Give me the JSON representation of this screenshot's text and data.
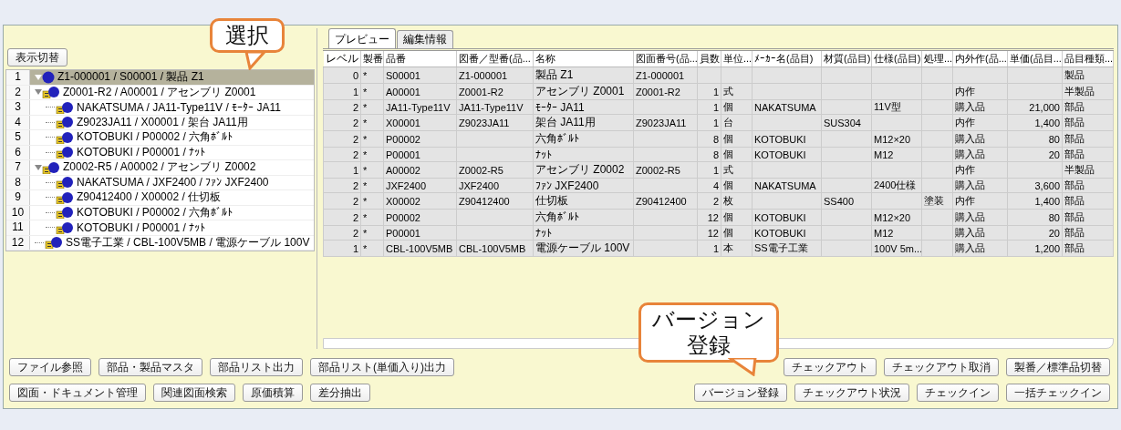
{
  "left_panel": {
    "toggle_button": "表示切替",
    "tree": [
      {
        "number": "1",
        "label": "Z1-000001 / S00001 / 製品 Z1",
        "selected": true,
        "expanded": true,
        "children": [
          {
            "number": "2",
            "label": "Z0001-R2 / A00001 / アセンブリ Z0001",
            "selected": false,
            "expanded": true,
            "children": [
              {
                "number": "3",
                "label": "NAKATSUMA / JA11-Type11V / ﾓｰﾀｰ JA11",
                "selected": false
              },
              {
                "number": "4",
                "label": "Z9023JA11 / X00001 / 架台 JA11用",
                "selected": false
              },
              {
                "number": "5",
                "label": "KOTOBUKI / P00002 / 六角ﾎﾞﾙﾄ",
                "selected": false
              },
              {
                "number": "6",
                "label": "KOTOBUKI / P00001 / ﾅｯﾄ",
                "selected": false
              }
            ]
          },
          {
            "number": "7",
            "label": "Z0002-R5 / A00002 / アセンブリ Z0002",
            "selected": false,
            "expanded": true,
            "children": [
              {
                "number": "8",
                "label": "NAKATSUMA / JXF2400 / ﾌｧﾝ JXF2400",
                "selected": false
              },
              {
                "number": "9",
                "label": "Z90412400 / X00002 / 仕切板",
                "selected": false
              },
              {
                "number": "10",
                "label": "KOTOBUKI / P00002 / 六角ﾎﾞﾙﾄ",
                "selected": false
              },
              {
                "number": "11",
                "label": "KOTOBUKI / P00001 / ﾅｯﾄ",
                "selected": false
              }
            ]
          },
          {
            "number": "12",
            "label": "SS電子工業 / CBL-100V5MB / 電源ケーブル 100V",
            "selected": false
          }
        ]
      }
    ]
  },
  "tabs": [
    {
      "label": "プレビュー",
      "selected": true
    },
    {
      "label": "編集情報",
      "selected": false
    }
  ],
  "table": {
    "columns": [
      "レベル",
      "製番",
      "品番",
      "図番／型番(品...",
      "名称",
      "図面番号(品...",
      "員数",
      "単位...",
      "ﾒｰｶｰ名(品目)",
      "材質(品目)",
      "仕様(品目)",
      "処理...",
      "内外作(品...",
      "単価(品目...",
      "品目種類..."
    ],
    "rows": [
      [
        "0",
        "*",
        "S00001",
        "Z1-000001",
        "製品 Z1",
        "Z1-000001",
        "",
        "",
        "",
        "",
        "",
        "",
        "",
        "",
        "製品"
      ],
      [
        "1",
        "*",
        "A00001",
        "Z0001-R2",
        "アセンブリ Z0001",
        "Z0001-R2",
        "1",
        "式",
        "",
        "",
        "",
        "",
        "内作",
        "",
        "半製品"
      ],
      [
        "2",
        "*",
        "JA11-Type11V",
        "JA11-Type11V",
        "ﾓｰﾀｰ JA11",
        "",
        "1",
        "個",
        "NAKATSUMA",
        "",
        "11V型",
        "",
        "購入品",
        "21,000",
        "部品"
      ],
      [
        "2",
        "*",
        "X00001",
        "Z9023JA11",
        "架台 JA11用",
        "Z9023JA11",
        "1",
        "台",
        "",
        "SUS304",
        "",
        "",
        "内作",
        "1,400",
        "部品"
      ],
      [
        "2",
        "*",
        "P00002",
        "",
        "六角ﾎﾞﾙﾄ",
        "",
        "8",
        "個",
        "KOTOBUKI",
        "",
        "M12×20",
        "",
        "購入品",
        "80",
        "部品"
      ],
      [
        "2",
        "*",
        "P00001",
        "",
        "ﾅｯﾄ",
        "",
        "8",
        "個",
        "KOTOBUKI",
        "",
        "M12",
        "",
        "購入品",
        "20",
        "部品"
      ],
      [
        "1",
        "*",
        "A00002",
        "Z0002-R5",
        "アセンブリ Z0002",
        "Z0002-R5",
        "1",
        "式",
        "",
        "",
        "",
        "",
        "内作",
        "",
        "半製品"
      ],
      [
        "2",
        "*",
        "JXF2400",
        "JXF2400",
        "ﾌｧﾝ JXF2400",
        "",
        "4",
        "個",
        "NAKATSUMA",
        "",
        "2400仕様",
        "",
        "購入品",
        "3,600",
        "部品"
      ],
      [
        "2",
        "*",
        "X00002",
        "Z90412400",
        "仕切板",
        "Z90412400",
        "2",
        "枚",
        "",
        "SS400",
        "",
        "塗装",
        "内作",
        "1,400",
        "部品"
      ],
      [
        "2",
        "*",
        "P00002",
        "",
        "六角ﾎﾞﾙﾄ",
        "",
        "12",
        "個",
        "KOTOBUKI",
        "",
        "M12×20",
        "",
        "購入品",
        "80",
        "部品"
      ],
      [
        "2",
        "*",
        "P00001",
        "",
        "ﾅｯﾄ",
        "",
        "12",
        "個",
        "KOTOBUKI",
        "",
        "M12",
        "",
        "購入品",
        "20",
        "部品"
      ],
      [
        "1",
        "*",
        "CBL-100V5MB",
        "CBL-100V5MB",
        "電源ケーブル 100V",
        "",
        "1",
        "本",
        "SS電子工業",
        "",
        "100V 5m...",
        "",
        "購入品",
        "1,200",
        "部品"
      ]
    ]
  },
  "buttons_left": [
    [
      "ファイル参照",
      "部品・製品マスタ",
      "部品リスト出力",
      "部品リスト(単価入り)出力"
    ],
    [
      "図面・ドキュメント管理",
      "関連図面検索",
      "原価積算",
      "差分抽出"
    ]
  ],
  "buttons_right": [
    [
      "チェックアウト",
      "チェックアウト取消",
      "製番／標準品切替"
    ],
    [
      "バージョン登録",
      "チェックアウト状況",
      "チェックイン",
      "一括チェックイン"
    ]
  ],
  "callouts": [
    {
      "lines": [
        "選択"
      ]
    },
    {
      "lines": [
        "バージョン",
        "登録"
      ]
    }
  ]
}
